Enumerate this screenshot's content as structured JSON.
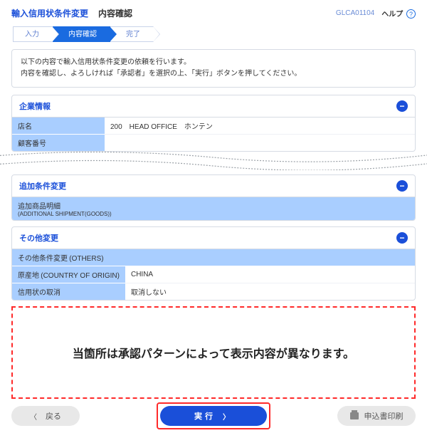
{
  "header": {
    "title": "輸入信用状条件変更",
    "subtitle": "内容確認",
    "screen_id": "GLCA01104",
    "help_label": "ヘルプ"
  },
  "steps": {
    "s1": "入力",
    "s2": "内容確認",
    "s3": "完了"
  },
  "intro": {
    "line1": "以下の内容で輸入信用状条件変更の依頼を行います。",
    "line2": "内容を確認し、よろしければ「承認者」を選択の上、「実行」ボタンを押してください。"
  },
  "sections": {
    "corp": {
      "title": "企業情報",
      "rows": {
        "branch_label": "店名",
        "branch_value": "200　HEAD OFFICE　ホンテン",
        "custno_label": "顧客番号",
        "custno_value": ""
      }
    },
    "addcond": {
      "title": "追加条件変更",
      "subhead_jp": "追加商品明細",
      "subhead_en": "(ADDITIONAL SHIPMENT(GOODS))"
    },
    "other": {
      "title": "その他変更",
      "subhead_jp": "その他条件変更",
      "subhead_en": "(OTHERS)",
      "rows": {
        "origin_label_jp": "原産地",
        "origin_label_en": "(COUNTRY OF ORIGIN)",
        "origin_value": "CHINA",
        "cancel_label": "信用状の取消",
        "cancel_value": "取消しない"
      }
    }
  },
  "approval_placeholder": "当箇所は承認パターンによって表示内容が異なります。",
  "actions": {
    "back": "戻る",
    "execute": "実行",
    "print": "申込書印刷"
  }
}
